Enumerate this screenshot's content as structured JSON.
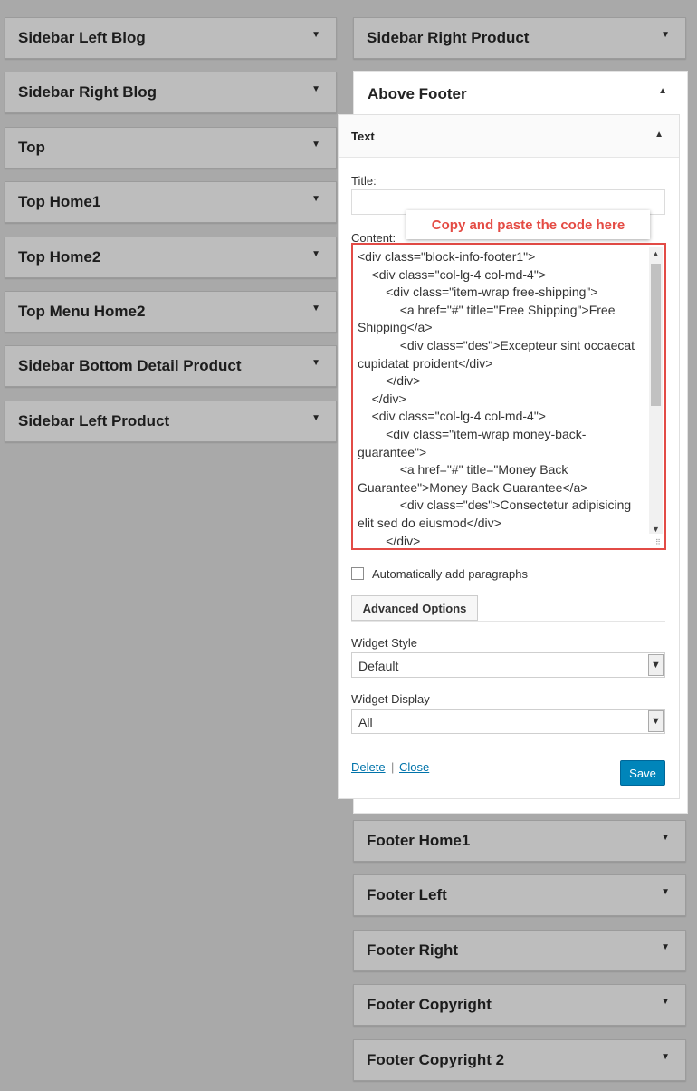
{
  "left_sidebars": [
    {
      "title": "Sidebar Left Blog"
    },
    {
      "title": "Sidebar Right Blog"
    },
    {
      "title": "Top"
    },
    {
      "title": "Top Home1"
    },
    {
      "title": "Top Home2"
    },
    {
      "title": "Top Menu Home2"
    },
    {
      "title": "Sidebar Bottom Detail Product"
    },
    {
      "title": "Sidebar Left Product"
    }
  ],
  "right_sidebars_top": [
    {
      "title": "Sidebar Right Product"
    }
  ],
  "above_footer": {
    "title": "Above Footer"
  },
  "text_widget": {
    "title": "Text",
    "title_label": "Title:",
    "title_value": "",
    "content_label": "Content:",
    "content": "<div class=\"block-info-footer1\">\n\t<div class=\"col-lg-4 col-md-4\">\n\t\t<div class=\"item-wrap free-shipping\">\n\t\t\t<a href=\"#\" title=\"Free Shipping\">Free Shipping</a>\n\t\t\t<div class=\"des\">Excepteur sint occaecat cupidatat proident</div>\n\t\t</div>\n\t</div>\n\t<div class=\"col-lg-4 col-md-4\">\n\t\t<div class=\"item-wrap money-back-guarantee\">\n\t\t\t<a href=\"#\" title=\"Money Back Guarantee\">Money Back Guarantee</a>\n\t\t\t<div class=\"des\">Consectetur adipisicing elit sed do eiusmod</div>\n\t\t</div>\n\t</div>",
    "auto_paragraphs_label": "Automatically add paragraphs",
    "advanced_options_label": "Advanced Options",
    "widget_style_label": "Widget Style",
    "widget_style_value": "Default",
    "widget_display_label": "Widget Display",
    "widget_display_value": "All",
    "delete_label": "Delete",
    "separator": "|",
    "close_label": "Close",
    "save_label": "Save"
  },
  "callout": {
    "text": "Copy and paste the code here"
  },
  "right_sidebars_bottom": [
    {
      "title": "Footer Home1"
    },
    {
      "title": "Footer Left"
    },
    {
      "title": "Footer Right"
    },
    {
      "title": "Footer Copyright"
    },
    {
      "title": "Footer Copyright 2"
    }
  ],
  "icons": {
    "collapsed": "▼",
    "expanded": "▲"
  },
  "colors": {
    "callout_text": "#e44b44",
    "highlight_border": "#e24b46",
    "save_button": "#0085ba",
    "link": "#0073aa"
  }
}
